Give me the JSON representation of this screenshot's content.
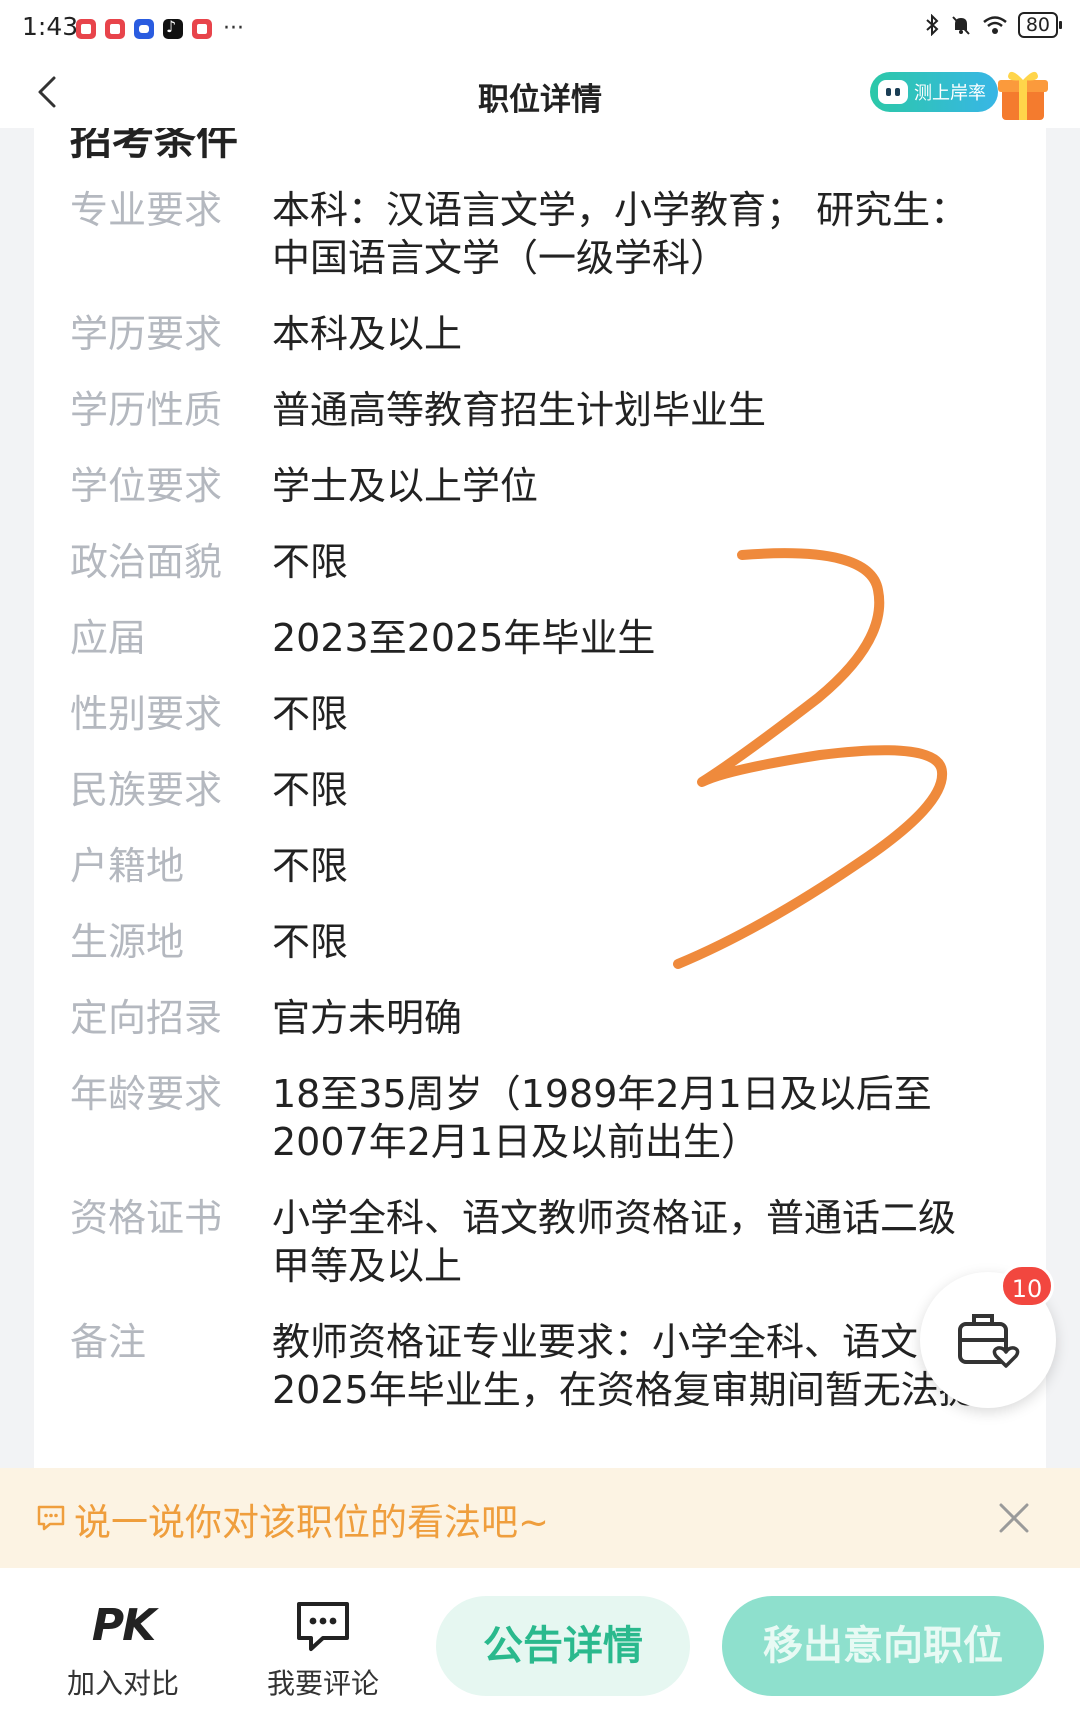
{
  "status_bar": {
    "time": "1:43",
    "notification_more": "···",
    "battery": "80"
  },
  "header": {
    "title": "职位详情",
    "measure_label": "测上岸率"
  },
  "section": {
    "title": "招考条件",
    "requirements": [
      {
        "label": "专业要求",
        "value": "本科：汉语言文学，小学教育；  研究生：\n中国语言文学（一级学科）"
      },
      {
        "label": "学历要求",
        "value": "本科及以上"
      },
      {
        "label": "学历性质",
        "value": "普通高等教育招生计划毕业生"
      },
      {
        "label": "学位要求",
        "value": "学士及以上学位"
      },
      {
        "label": "政治面貌",
        "value": "不限"
      },
      {
        "label": "应届",
        "value": "2023至2025年毕业生"
      },
      {
        "label": "性别要求",
        "value": "不限"
      },
      {
        "label": "民族要求",
        "value": "不限"
      },
      {
        "label": "户籍地",
        "value": "不限"
      },
      {
        "label": "生源地",
        "value": "不限"
      },
      {
        "label": "定向招录",
        "value": "官方未明确"
      },
      {
        "label": "年龄要求",
        "value": "18至35周岁（1989年2月1日及以后至\n2007年2月1日及以前出生）"
      },
      {
        "label": "资格证书",
        "value": "小学全科、语文教师资格证，普通话二级\n甲等及以上"
      },
      {
        "label": "备注",
        "value": "教师资格证专业要求：小学全科、语文；\n2025年毕业生，在资格复审期间暂无法提"
      }
    ]
  },
  "float_cart": {
    "badge": "10"
  },
  "comment_prompt": {
    "text": "说一说你对该职位的看法吧~"
  },
  "bottom_bar": {
    "pk_icon_text": "PK",
    "compare_label": "加入对比",
    "comment_label": "我要评论",
    "announcement_button": "公告详情",
    "remove_button": "移出意向职位"
  },
  "colors": {
    "accent_green": "#2ab98d",
    "prompt_orange": "#ef9e3d",
    "badge_red": "#f2473f",
    "scribble_orange": "#ef8a3c"
  }
}
